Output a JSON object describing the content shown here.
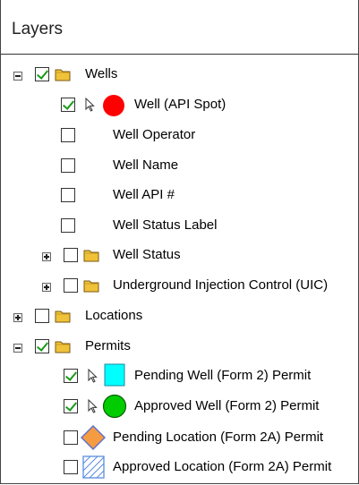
{
  "panel": {
    "title": "Layers"
  },
  "layers": {
    "wells": {
      "label": "Wells",
      "api_spot": "Well (API Spot)",
      "operator": "Well Operator",
      "name": "Well Name",
      "api_num": "Well API #",
      "status_label": "Well Status Label",
      "status": "Well Status",
      "uic": "Underground Injection Control (UIC)"
    },
    "locations": {
      "label": "Locations"
    },
    "permits": {
      "label": "Permits",
      "pending_well": "Pending Well (Form 2) Permit",
      "approved_well": "Approved Well (Form 2) Permit",
      "pending_location": "Pending Location (Form 2A) Permit",
      "approved_location": "Approved Location (Form 2A) Permit"
    }
  },
  "symbols": {
    "well_spot": "#ff0000",
    "pending_well": "#00ffff",
    "approved_well": "#00cc00",
    "pending_location": "#f59b42",
    "approved_location": "#5a8de0"
  }
}
